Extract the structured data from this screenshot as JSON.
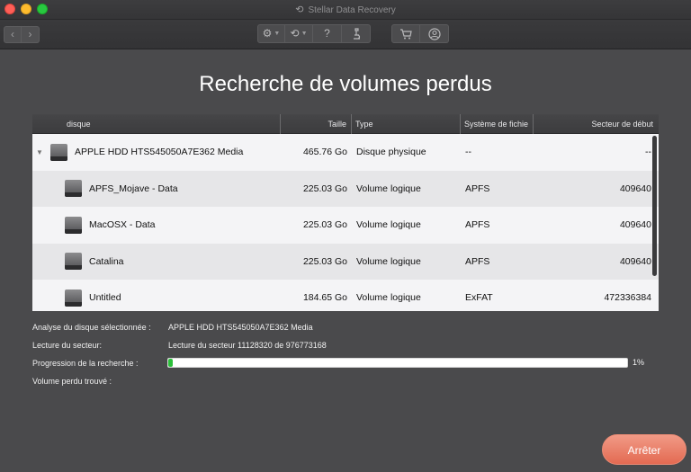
{
  "window": {
    "title": "Stellar Data Recovery"
  },
  "toolbar": {
    "nav_back_icon": "chevron-left-icon",
    "nav_forward_icon": "chevron-right-icon",
    "gear_glyph": "⚙",
    "history_glyph": "⟲",
    "help_glyph": "?",
    "microscope_glyph": "🔬",
    "cart_glyph": "🛒",
    "account_glyph": "◯"
  },
  "heading": "Recherche de volumes perdus",
  "table": {
    "columns": [
      "disque",
      "Taille",
      "Type",
      "Système de fichie",
      "Secteur de début"
    ],
    "rows": [
      {
        "name": "APPLE HDD HTS545050A7E362 Media",
        "size": "465.76 Go",
        "type": "Disque physique",
        "fs": "--",
        "start": "--",
        "level": 0,
        "expanded": true
      },
      {
        "name": "APFS_Mojave - Data",
        "size": "225.03 Go",
        "type": "Volume logique",
        "fs": "APFS",
        "start": "409640",
        "level": 1
      },
      {
        "name": "MacOSX - Data",
        "size": "225.03 Go",
        "type": "Volume logique",
        "fs": "APFS",
        "start": "409640",
        "level": 1
      },
      {
        "name": "Catalina",
        "size": "225.03 Go",
        "type": "Volume logique",
        "fs": "APFS",
        "start": "409640",
        "level": 1
      },
      {
        "name": "Untitled",
        "size": "184.65 Go",
        "type": "Volume logique",
        "fs": "ExFAT",
        "start": "472336384",
        "level": 1
      }
    ]
  },
  "status": {
    "disk_label": "Analyse du disque sélectionnée :",
    "disk_value": "APPLE HDD HTS545050A7E362 Media",
    "sector_label": "Lecture du secteur:",
    "sector_value": "Lecture du secteur 11128320 de 976773168",
    "progress_label": "Progression de la recherche :",
    "progress_percent": "1%",
    "progress_fraction": 0.01,
    "lost_label": "Volume perdu trouvé :"
  },
  "actions": {
    "stop_label": "Arrêter"
  },
  "colors": {
    "accent": "#e36a52",
    "progress": "#2bbf3a",
    "background": "#4a4a4c"
  }
}
